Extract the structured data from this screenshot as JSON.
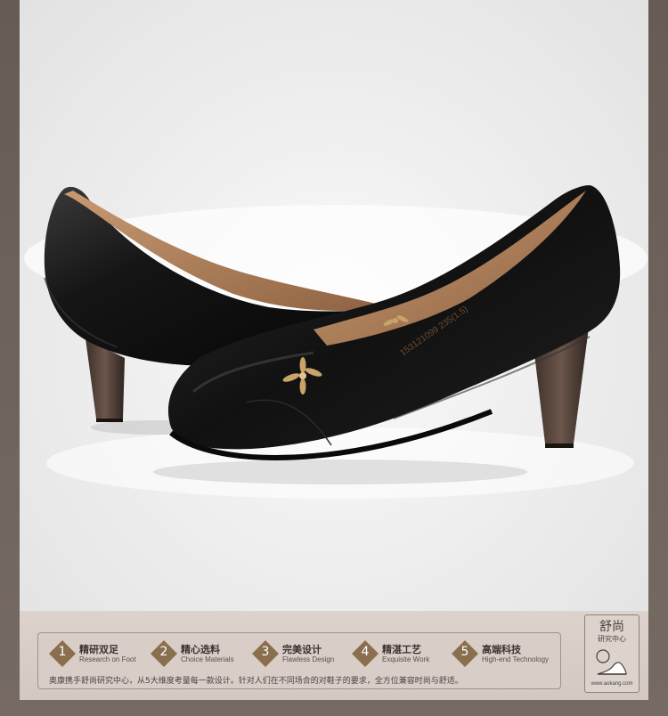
{
  "features": [
    {
      "number": "1",
      "title_cn": "精研双足",
      "title_en": "Research on Foot"
    },
    {
      "number": "2",
      "title_cn": "精心选料",
      "title_en": "Choice Materials"
    },
    {
      "number": "3",
      "title_cn": "完美设计",
      "title_en": "Flawless Design"
    },
    {
      "number": "4",
      "title_cn": "精湛工艺",
      "title_en": "Exquisite Work"
    },
    {
      "number": "5",
      "title_cn": "高端科技",
      "title_en": "High-end Technology"
    }
  ],
  "description": "奥康携手舒尚研究中心，从5大维度考量每一款设计。针对人们在不同场合的对鞋子的要求，全方位兼容时尚与舒适。",
  "logo": {
    "title": "舒尚",
    "subtitle": "研究中心",
    "url": "www.aokang.com",
    "icon": "shoe-in-circle-icon"
  },
  "product": {
    "insole_print": "153121099 235(1.5)"
  },
  "colors": {
    "frame": "#6f655e",
    "band": "#d8cdc7",
    "number_badge": "#8a6f4f",
    "leather": "#141414",
    "lining": "#b5855f",
    "heel": "#4a3a32",
    "ornament": "#c8a36a"
  }
}
